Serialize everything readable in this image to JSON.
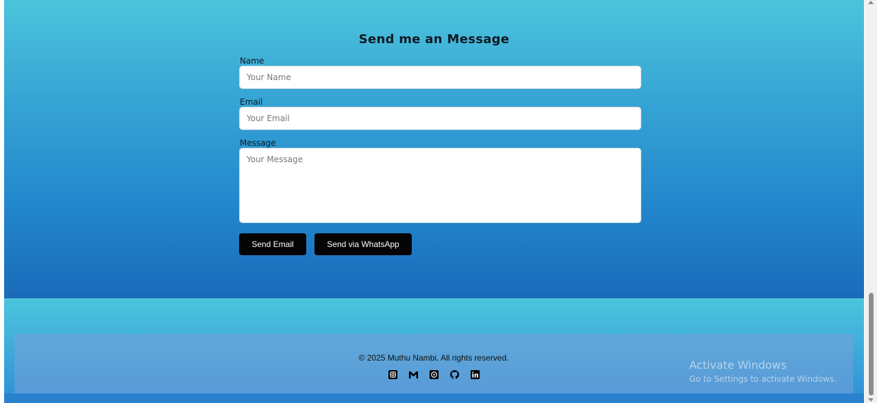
{
  "contact": {
    "title": "Send me an Message",
    "name_label": "Name",
    "name_placeholder": "Your Name",
    "email_label": "Email",
    "email_placeholder": "Your Email",
    "message_label": "Message",
    "message_placeholder": "Your Message",
    "send_email_label": "Send Email",
    "send_whatsapp_label": "Send via WhatsApp"
  },
  "footer": {
    "copyright": "© 2025 Muthu Nambi. All rights reserved.",
    "social_icons": [
      "instagram-icon",
      "gmail-icon",
      "whatsapp-icon",
      "github-icon",
      "linkedin-icon"
    ]
  },
  "watermark": {
    "title": "Activate Windows",
    "subtitle": "Go to Settings to activate Windows."
  },
  "colors": {
    "button_bg": "#050505",
    "gradient_top": "#4cc4dc",
    "gradient_bottom": "#1a6bba"
  }
}
